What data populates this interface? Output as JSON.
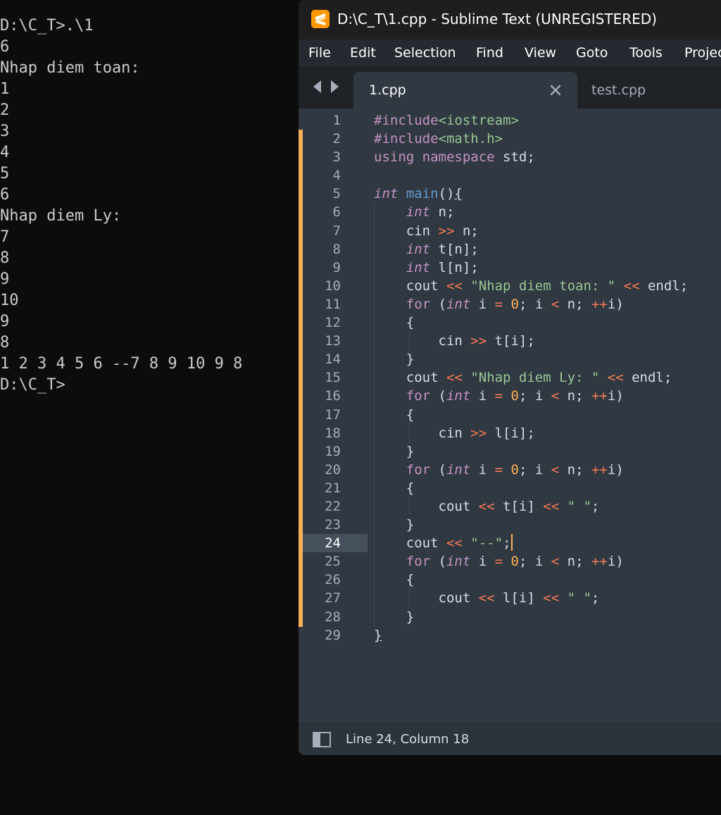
{
  "console": {
    "lines": [
      "D:\\C_T>.\\1",
      "6",
      "Nhap diem toan:",
      "1",
      "2",
      "3",
      "4",
      "5",
      "6",
      "Nhap diem Ly:",
      "7",
      "8",
      "9",
      "10",
      "9",
      "8",
      "1 2 3 4 5 6 --7 8 9 10 9 8",
      "D:\\C_T>"
    ]
  },
  "editor_window": {
    "title": "D:\\C_T\\1.cpp - Sublime Text (UNREGISTERED)",
    "icon": "sublime-text-icon",
    "accent_color": "#ff9800",
    "menu": [
      "File",
      "Edit",
      "Selection",
      "Find",
      "View",
      "Goto",
      "Tools",
      "Project"
    ],
    "tabs": [
      {
        "label": "1.cpp",
        "active": true
      },
      {
        "label": "test.cpp",
        "active": false
      }
    ],
    "current_line": 24,
    "status": "Line 24, Column 18"
  },
  "code": {
    "line_numbers": [
      "1",
      "2",
      "3",
      "4",
      "5",
      "6",
      "7",
      "8",
      "9",
      "10",
      "11",
      "12",
      "13",
      "14",
      "15",
      "16",
      "17",
      "18",
      "19",
      "20",
      "21",
      "22",
      "23",
      "24",
      "25",
      "26",
      "27",
      "28",
      "29"
    ],
    "lines": [
      [
        [
          "pre",
          "#include"
        ],
        [
          "inc",
          "<iostream>"
        ]
      ],
      [
        [
          "pre",
          "#include"
        ],
        [
          "inc",
          "<math.h>"
        ]
      ],
      [
        [
          "kw",
          "using"
        ],
        [
          "id",
          " "
        ],
        [
          "kw",
          "namespace"
        ],
        [
          "id",
          " std;"
        ]
      ],
      [],
      [
        [
          "type",
          "int"
        ],
        [
          "id",
          " "
        ],
        [
          "fn",
          "main"
        ],
        [
          "pn",
          "()"
        ],
        [
          "ul",
          "{"
        ]
      ],
      [
        [
          "id",
          "    "
        ],
        [
          "type",
          "int"
        ],
        [
          "id",
          " n;"
        ]
      ],
      [
        [
          "id",
          "    cin "
        ],
        [
          "op",
          ">>"
        ],
        [
          "id",
          " n;"
        ]
      ],
      [
        [
          "id",
          "    "
        ],
        [
          "type",
          "int"
        ],
        [
          "id",
          " t[n];"
        ]
      ],
      [
        [
          "id",
          "    "
        ],
        [
          "type",
          "int"
        ],
        [
          "id",
          " l[n];"
        ]
      ],
      [
        [
          "id",
          "    cout "
        ],
        [
          "op",
          "<<"
        ],
        [
          "id",
          " "
        ],
        [
          "str",
          "\"Nhap diem toan: \""
        ],
        [
          "id",
          " "
        ],
        [
          "op",
          "<<"
        ],
        [
          "id",
          " endl;"
        ]
      ],
      [
        [
          "id",
          "    "
        ],
        [
          "kw",
          "for"
        ],
        [
          "id",
          " ("
        ],
        [
          "type",
          "int"
        ],
        [
          "id",
          " i "
        ],
        [
          "op",
          "="
        ],
        [
          "id",
          " "
        ],
        [
          "num",
          "0"
        ],
        [
          "id",
          "; i "
        ],
        [
          "op",
          "<"
        ],
        [
          "id",
          " n; "
        ],
        [
          "op",
          "++"
        ],
        [
          "id",
          "i)"
        ]
      ],
      [
        [
          "id",
          "    {"
        ]
      ],
      [
        [
          "id",
          "        cin "
        ],
        [
          "op",
          ">>"
        ],
        [
          "id",
          " t[i];"
        ]
      ],
      [
        [
          "id",
          "    }"
        ]
      ],
      [
        [
          "id",
          "    cout "
        ],
        [
          "op",
          "<<"
        ],
        [
          "id",
          " "
        ],
        [
          "str",
          "\"Nhap diem Ly: \""
        ],
        [
          "id",
          " "
        ],
        [
          "op",
          "<<"
        ],
        [
          "id",
          " endl;"
        ]
      ],
      [
        [
          "id",
          "    "
        ],
        [
          "kw",
          "for"
        ],
        [
          "id",
          " ("
        ],
        [
          "type",
          "int"
        ],
        [
          "id",
          " i "
        ],
        [
          "op",
          "="
        ],
        [
          "id",
          " "
        ],
        [
          "num",
          "0"
        ],
        [
          "id",
          "; i "
        ],
        [
          "op",
          "<"
        ],
        [
          "id",
          " n; "
        ],
        [
          "op",
          "++"
        ],
        [
          "id",
          "i)"
        ]
      ],
      [
        [
          "id",
          "    {"
        ]
      ],
      [
        [
          "id",
          "        cin "
        ],
        [
          "op",
          ">>"
        ],
        [
          "id",
          " l[i];"
        ]
      ],
      [
        [
          "id",
          "    }"
        ]
      ],
      [
        [
          "id",
          "    "
        ],
        [
          "kw",
          "for"
        ],
        [
          "id",
          " ("
        ],
        [
          "type",
          "int"
        ],
        [
          "id",
          " i "
        ],
        [
          "op",
          "="
        ],
        [
          "id",
          " "
        ],
        [
          "num",
          "0"
        ],
        [
          "id",
          "; i "
        ],
        [
          "op",
          "<"
        ],
        [
          "id",
          " n; "
        ],
        [
          "op",
          "++"
        ],
        [
          "id",
          "i)"
        ]
      ],
      [
        [
          "id",
          "    {"
        ]
      ],
      [
        [
          "id",
          "        cout "
        ],
        [
          "op",
          "<<"
        ],
        [
          "id",
          " t[i] "
        ],
        [
          "op",
          "<<"
        ],
        [
          "id",
          " "
        ],
        [
          "str",
          "\" \""
        ],
        [
          "id",
          ";"
        ]
      ],
      [
        [
          "id",
          "    }"
        ]
      ],
      [
        [
          "id",
          "    cout "
        ],
        [
          "op",
          "<<"
        ],
        [
          "id",
          " "
        ],
        [
          "str",
          "\"--\""
        ],
        [
          "id",
          ";"
        ],
        [
          "cursor",
          ""
        ]
      ],
      [
        [
          "id",
          "    "
        ],
        [
          "kw",
          "for"
        ],
        [
          "id",
          " ("
        ],
        [
          "type",
          "int"
        ],
        [
          "id",
          " i "
        ],
        [
          "op",
          "="
        ],
        [
          "id",
          " "
        ],
        [
          "num",
          "0"
        ],
        [
          "id",
          "; i "
        ],
        [
          "op",
          "<"
        ],
        [
          "id",
          " n; "
        ],
        [
          "op",
          "++"
        ],
        [
          "id",
          "i)"
        ]
      ],
      [
        [
          "id",
          "    {"
        ]
      ],
      [
        [
          "id",
          "        cout "
        ],
        [
          "op",
          "<<"
        ],
        [
          "id",
          " l[i] "
        ],
        [
          "op",
          "<<"
        ],
        [
          "id",
          " "
        ],
        [
          "str",
          "\" \""
        ],
        [
          "id",
          ";"
        ]
      ],
      [
        [
          "id",
          "    }"
        ]
      ],
      [
        [
          "ul",
          "}"
        ]
      ]
    ]
  }
}
